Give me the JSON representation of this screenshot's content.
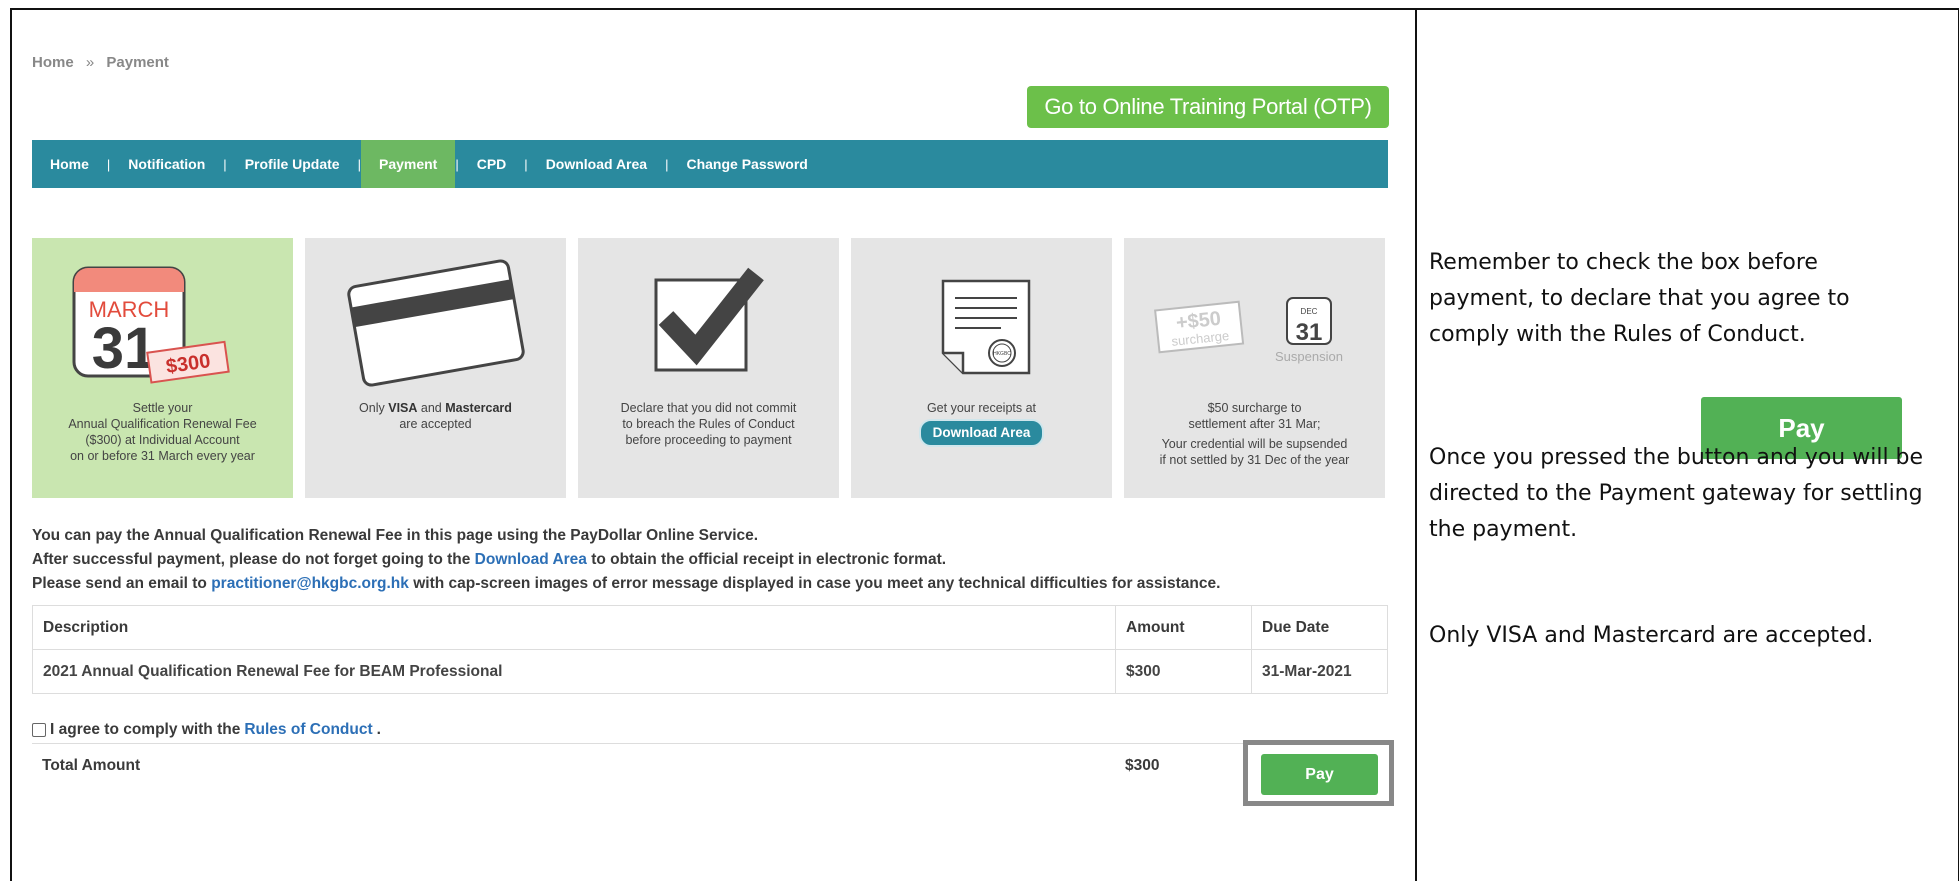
{
  "breadcrumb": {
    "home": "Home",
    "separator": "»",
    "current": "Payment"
  },
  "otp_button": "Go to Online Training Portal (OTP)",
  "nav": {
    "items": [
      "Home",
      "Notification",
      "Profile Update",
      "Payment",
      "CPD",
      "Download Area",
      "Change Password"
    ],
    "active": "Payment",
    "separator": "|"
  },
  "tiles": {
    "t1": {
      "cal_month": "MARCH",
      "cal_day": "31",
      "fee_tag": "$300",
      "text": [
        "Settle your",
        "Annual Qualification Renewal Fee",
        "($300) at Individual Account",
        "on or before 31 March every year"
      ]
    },
    "t2": {
      "text_pre": "Only ",
      "visa": "VISA",
      "and": " and ",
      "mastercard": "Mastercard",
      "text_line2": "are accepted"
    },
    "t3": {
      "text": [
        "Declare that you did not commit",
        "to breach the Rules of Conduct",
        "before proceeding to payment"
      ]
    },
    "t4": {
      "seal": "HKGBC",
      "text": "Get your receipts at",
      "pill": "Download Area"
    },
    "t5": {
      "surcharge_amount": "+$50",
      "surcharge_word": "surcharge",
      "dec_month": "DEC",
      "dec_day": "31",
      "suspension": "Suspension",
      "text": [
        "$50 surcharge to",
        "settlement after 31 Mar;",
        "Your credential will be supsended",
        "if not settled by 31 Dec of the year"
      ]
    }
  },
  "info": {
    "line1": "You can pay the Annual Qualification Renewal Fee in this page using the PayDollar Online Service.",
    "line2_pre": "After successful payment, please do not forget going to the ",
    "line2_link": "Download Area",
    "line2_post": " to obtain the official receipt in electronic format.",
    "line3_pre": "Please send an email to ",
    "line3_link": "practitioner@hkgbc.org.hk",
    "line3_post": " with cap-screen images of error message displayed in case you meet any technical difficulties for assistance."
  },
  "table": {
    "headers": {
      "description": "Description",
      "amount": "Amount",
      "due_date": "Due Date"
    },
    "rows": [
      {
        "description": "2021 Annual Qualification Renewal Fee for BEAM Professional",
        "amount": "$300",
        "due_date": "31-Mar-2021"
      }
    ]
  },
  "agree": {
    "pre": "I agree to comply with the ",
    "link": "Rules of Conduct",
    "post": "."
  },
  "total": {
    "label": "Total Amount",
    "amount": "$300"
  },
  "pay_button": "Pay",
  "notes": {
    "note1": "Remember to check the box before payment, to declare that you agree to comply with the Rules of Conduct.",
    "note2": "Once you pressed the button and you will be directed to the Payment gateway for settling the payment.",
    "note3": "Only VISA and Mastercard are accepted.",
    "demo_pay": "Pay"
  },
  "colors": {
    "teal": "#2a8a9e",
    "green": "#52b155",
    "nav_active": "#6db862",
    "otp": "#6cc04a",
    "link": "#2c6fb6"
  }
}
